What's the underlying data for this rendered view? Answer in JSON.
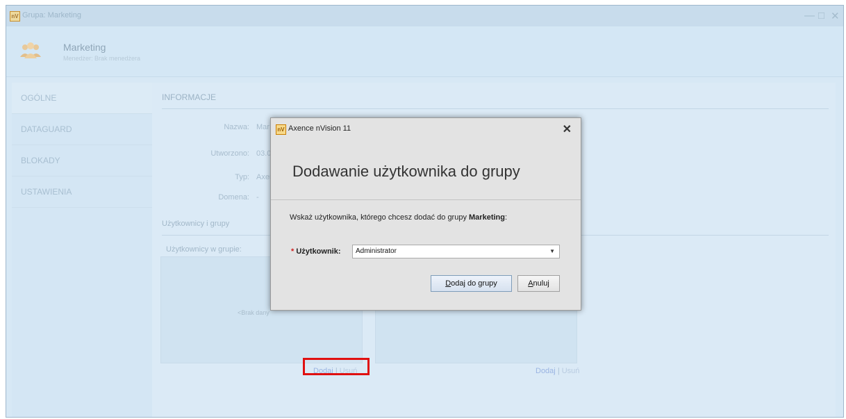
{
  "window": {
    "title": "Grupa: Marketing",
    "logo_text": "nV",
    "minimize_glyph": "—",
    "maximize_glyph": "□",
    "close_glyph": "✕"
  },
  "header": {
    "group_name": "Marketing",
    "manager_line": "Menedżer: Brak menedżera",
    "avatar_icon": "group-users-icon"
  },
  "sidebar": {
    "items": [
      {
        "label": "OGÓLNE",
        "active": true
      },
      {
        "label": "DATAGUARD"
      },
      {
        "label": "BLOKADY"
      },
      {
        "label": "USTAWIENIA"
      }
    ]
  },
  "main": {
    "section_title": "INFORMACJE",
    "fields": {
      "name_label": "Nazwa:",
      "name_value": "Mar",
      "created_label": "Utworzono:",
      "created_value": "03.0",
      "type_label": "Typ:",
      "type_value": "Axen",
      "domain_label": "Domena:",
      "domain_value": "-"
    },
    "users_section": "Użytkownicy i grupy",
    "users_in_group": "Użytkownicy w grupie:",
    "empty_text": "<Brak dany",
    "left_links": {
      "add": "Dodaj",
      "separator": "|",
      "remove": "Usuń"
    },
    "right_links": {
      "add": "Dodaj",
      "separator": "|",
      "remove": "Usuń"
    }
  },
  "dialog": {
    "title": "Axence nVision 11",
    "logo_text": "nV",
    "close_glyph": "✕",
    "heading": "Dodawanie użytkownika do grupy",
    "prompt_prefix": "Wskaż użytkownika, którego chcesz dodać do grupy ",
    "prompt_group": "Marketing",
    "prompt_suffix": ":",
    "required_mark": "*",
    "user_label": "Użytkownik:",
    "user_value": "Administrator",
    "add_button": "Dodaj do grupy",
    "cancel_button": "Anuluj"
  },
  "colors": {
    "highlight_border": "#e01010",
    "background": "#d7e8f5",
    "link": "#9ab4e2"
  }
}
